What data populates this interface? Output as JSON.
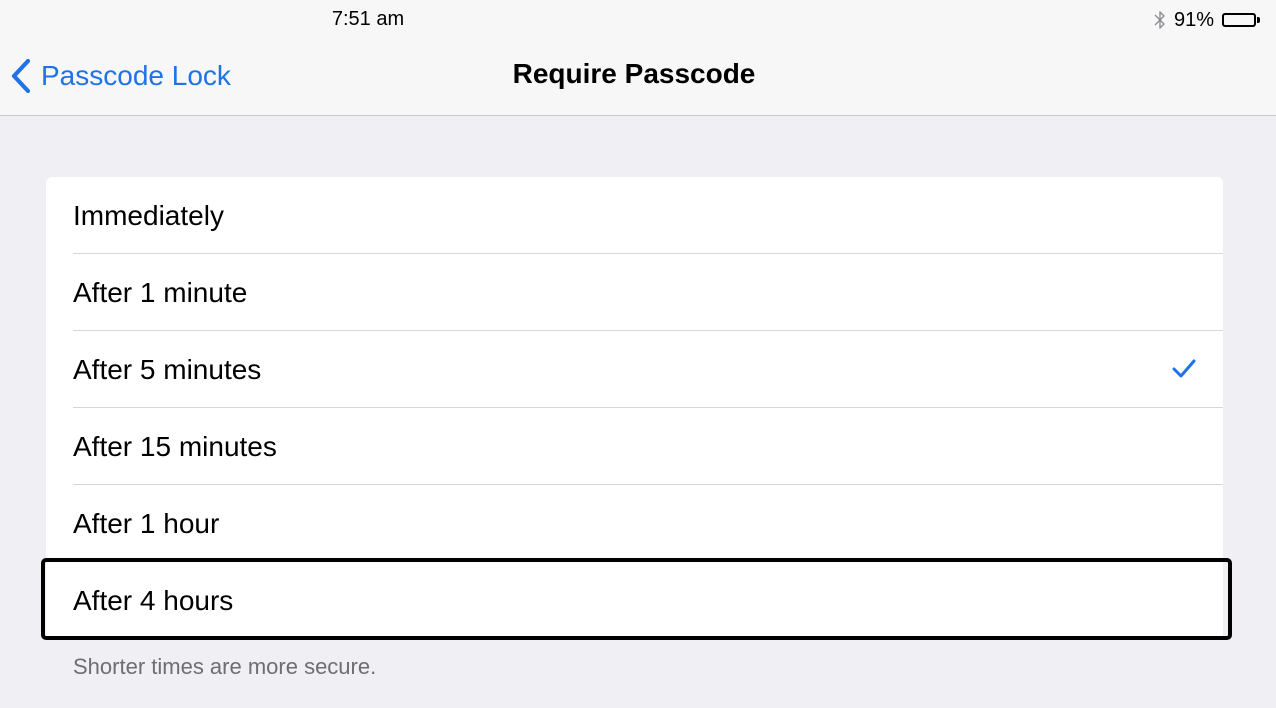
{
  "status_bar": {
    "time": "7:51 am",
    "battery_percent": "91%",
    "battery_level": 0.91,
    "bluetooth_icon": "bluetooth-icon",
    "battery_icon": "battery-icon"
  },
  "nav": {
    "back_label": "Passcode Lock",
    "back_icon": "chevron-left-icon",
    "title": "Require Passcode",
    "accent_color": "#1e73e6"
  },
  "options": [
    {
      "label": "Immediately",
      "selected": false
    },
    {
      "label": "After 1 minute",
      "selected": false
    },
    {
      "label": "After 5 minutes",
      "selected": true
    },
    {
      "label": "After 15 minutes",
      "selected": false
    },
    {
      "label": "After 1 hour",
      "selected": false
    },
    {
      "label": "After 4 hours",
      "selected": false
    }
  ],
  "selected_icon": "checkmark-icon",
  "footer": "Shorter times are more secure.",
  "colors": {
    "background": "#efeff4",
    "checkmark": "#1e73e6",
    "footer_text": "#6d6d72",
    "highlight_border": "#000000"
  }
}
